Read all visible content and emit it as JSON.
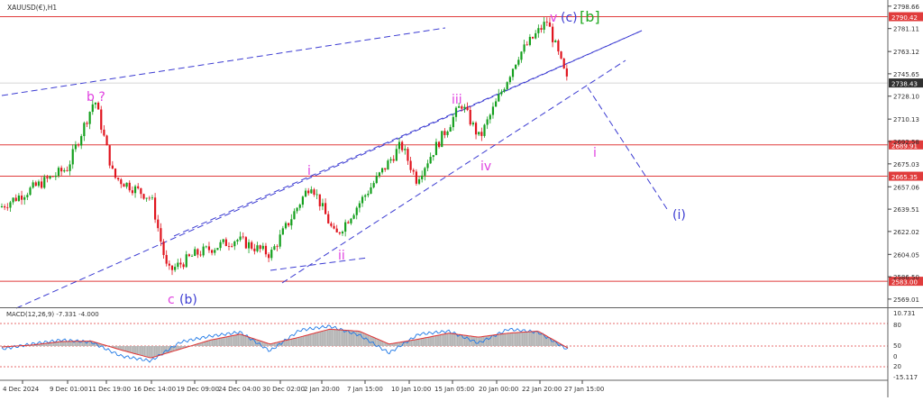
{
  "window": {
    "title": "XAUUSD(€),H1"
  },
  "colors": {
    "bull": "#15a01e",
    "bear": "#e0141e",
    "level": "#e03c3c",
    "channel": "#3c3cd2",
    "wave_magenta": "#e040e0",
    "wave_blue": "#3c3cd2",
    "wave_green": "#22aa22",
    "macd_hist": "#b4b4b4",
    "macd_line": "#1e78e6",
    "signal_line": "#e03232",
    "axis": "#404040"
  },
  "chart_data": [
    {
      "type": "candlestick",
      "title": "XAUUSD(€),H1",
      "symbol": "XAUUSD",
      "timeframe": "H1",
      "y_ticks": [
        2798.66,
        2781.11,
        2763.12,
        2745.65,
        2728.1,
        2710.13,
        2692.58,
        2675.03,
        2657.06,
        2639.51,
        2622.02,
        2604.05,
        2586.5,
        2569.01
      ],
      "ylim": [
        2564.0,
        2803.5
      ],
      "x_ticks": [
        "4 Dec 2024",
        "9 Dec 01:00",
        "11 Dec 19:00",
        "16 Dec 14:00",
        "19 Dec 09:00",
        "24 Dec 04:00",
        "30 Dec 02:00",
        "2 Jan 20:00",
        "7 Jan 15:00",
        "10 Jan 10:00",
        "15 Jan 05:00",
        "20 Jan 00:00",
        "22 Jan 20:00",
        "27 Jan 15:00"
      ],
      "price_path": [
        {
          "t": "4 Dec 2024",
          "price": 2641
        },
        {
          "t": "9 Dec 01:00",
          "price": 2672
        },
        {
          "t": "11 Dec 19:00",
          "price": 2726
        },
        {
          "t": "13 Dec",
          "price": 2665
        },
        {
          "t": "16 Dec 14:00",
          "price": 2648
        },
        {
          "t": "18 Dec",
          "price": 2590
        },
        {
          "t": "19 Dec 09:00",
          "price": 2604
        },
        {
          "t": "24 Dec 04:00",
          "price": 2616
        },
        {
          "t": "30 Dec 02:00",
          "price": 2604
        },
        {
          "t": "2 Jan 20:00",
          "price": 2660
        },
        {
          "t": "6 Jan",
          "price": 2618
        },
        {
          "t": "10 Jan 10:00",
          "price": 2690
        },
        {
          "t": "13 Jan",
          "price": 2663
        },
        {
          "t": "15 Jan 05:00",
          "price": 2722
        },
        {
          "t": "20 Jan 00:00",
          "price": 2695
        },
        {
          "t": "22 Jan 20:00",
          "price": 2760
        },
        {
          "t": "24 Jan",
          "price": 2787
        },
        {
          "t": "27 Jan 15:00",
          "price": 2738
        }
      ],
      "horizontal_levels": [
        2790.42,
        2689.91,
        2665.35,
        2583.0
      ],
      "current_price": 2738.43,
      "wave_labels": [
        "b ?",
        "c (b)",
        "i",
        "ii",
        "iii",
        "iv",
        "v",
        "(c)",
        "[b]",
        "i",
        "(i)"
      ]
    },
    {
      "type": "line",
      "title": "MACD(12,26,9) -7.331 -4.000",
      "series": [
        {
          "name": "MACD",
          "values": [
            -6,
            4,
            12,
            8,
            -20,
            -30,
            8,
            20,
            28,
            -10,
            32,
            40,
            22,
            -14,
            24,
            30,
            6,
            34,
            28,
            -7.331
          ]
        },
        {
          "name": "Signal",
          "values": [
            -2,
            2,
            9,
            10,
            -8,
            -24,
            -6,
            12,
            24,
            4,
            18,
            34,
            30,
            4,
            14,
            26,
            18,
            26,
            30,
            -4.0
          ]
        }
      ],
      "y_ticks": [
        10.731,
        80,
        50,
        0,
        20,
        -15.117
      ],
      "reference_levels": [
        80,
        0
      ]
    }
  ],
  "annotations": {
    "b_q": "b ?",
    "c_b_c": "c",
    "c_b_b": "(b)",
    "i_up": "i",
    "ii": "ii",
    "iii": "iii",
    "iv": "iv",
    "v": "v",
    "c_top": "(c)",
    "bb": "[b]",
    "i_down": "i",
    "i_paren": "(i)"
  }
}
